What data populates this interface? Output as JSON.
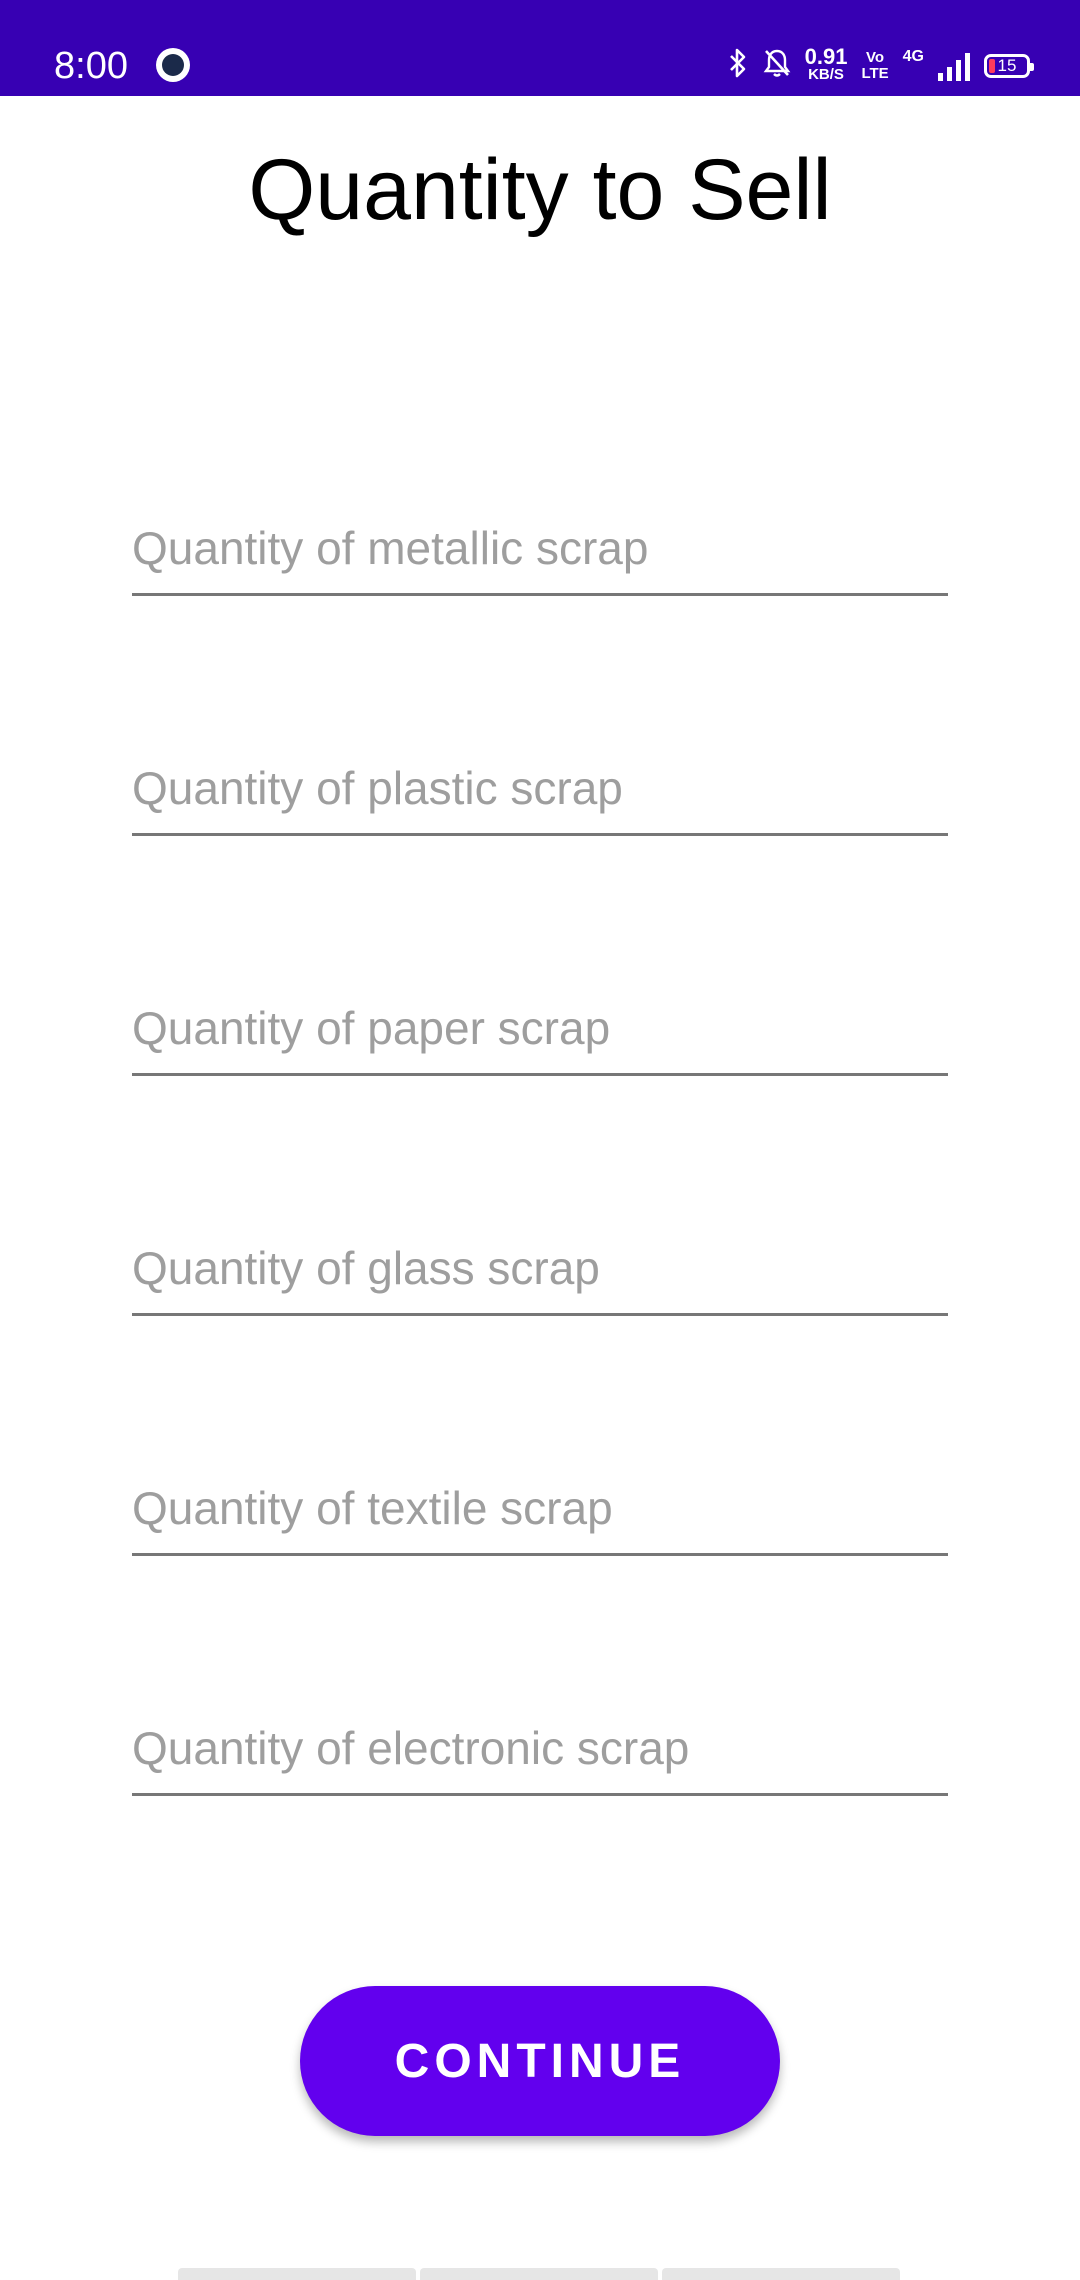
{
  "status_bar": {
    "time": "8:00",
    "speed_value": "0.91",
    "speed_unit": "KB/S",
    "volte_top": "Vo",
    "volte_bottom": "LTE",
    "network": "4G",
    "battery": "15",
    "icons": [
      "app-notification-icon",
      "bluetooth-icon",
      "bell-off-icon",
      "signal-icon",
      "battery-icon"
    ]
  },
  "page": {
    "title": "Quantity to Sell"
  },
  "fields": [
    {
      "placeholder": "Quantity of metallic scrap",
      "value": ""
    },
    {
      "placeholder": "Quantity of plastic scrap",
      "value": ""
    },
    {
      "placeholder": "Quantity of paper scrap",
      "value": ""
    },
    {
      "placeholder": "Quantity of glass scrap",
      "value": ""
    },
    {
      "placeholder": "Quantity of textile scrap",
      "value": ""
    },
    {
      "placeholder": "Quantity of electronic scrap",
      "value": ""
    }
  ],
  "actions": {
    "continue_label": "CONTINUE"
  },
  "colors": {
    "status_bar": "#3700b3",
    "primary": "#6200ee",
    "placeholder": "#9e9e9e",
    "underline": "#777777"
  }
}
